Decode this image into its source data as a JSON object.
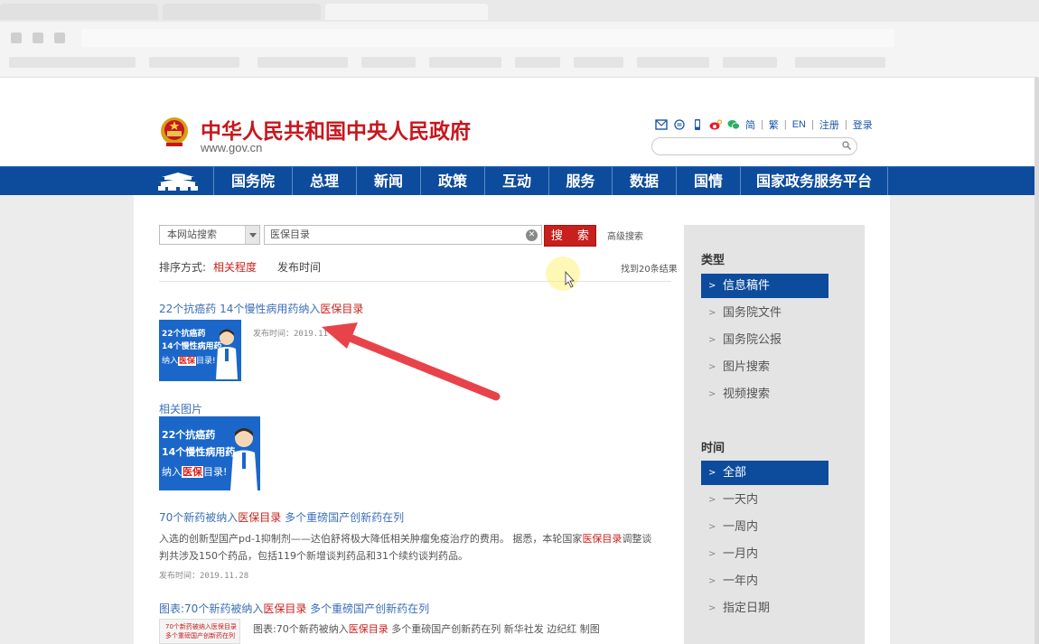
{
  "header": {
    "site_title": "中华人民共和国中央人民政府",
    "site_url": "www.gov.cn",
    "links": [
      "简",
      "繁",
      "EN",
      "注册",
      "登录"
    ],
    "icons": [
      "mail-icon",
      "rss-icon",
      "mobile-icon",
      "weibo-icon",
      "wechat-icon"
    ]
  },
  "nav": {
    "items": [
      "国务院",
      "总理",
      "新闻",
      "政策",
      "互动",
      "服务",
      "数据",
      "国情",
      "国家政务服务平台"
    ]
  },
  "search": {
    "scope": "本网站搜索",
    "query": "医保目录",
    "button": "搜 索",
    "advanced": "高级搜索"
  },
  "sort": {
    "label": "排序方式:",
    "relevance": "相关程度",
    "time": "发布时间",
    "found": "找到20条结果"
  },
  "results": [
    {
      "title_pre": "22个抗癌药 14个慢性病用药纳入",
      "title_hl": "医保目录",
      "meta": "发布时间：2019.11",
      "thumb_lines": [
        "22个抗癌药",
        "14个慢性病用药",
        "纳入",
        "医保",
        "目录!"
      ]
    },
    {
      "title": "相关图片",
      "thumb_lines": [
        "22个抗癌药",
        "14个慢性病用药",
        "纳入",
        "医保",
        "目录!"
      ]
    },
    {
      "title_pre": "70个新药被纳入",
      "title_hl": "医保目录",
      "title_post": "  多个重磅国产创新药在列",
      "line1_pre": "入选的创新型国产pd-1抑制剂——达伯舒将极大降低相关肿瘤免疫治疗的费用。 据悉，本轮国家",
      "line1_hl": "医保目录",
      "line1_post": "调整谈",
      "line2": "判共涉及150个药品，包括119个新增谈判药品和31个续约谈判药品。",
      "meta": "发布时间：2019.11.28"
    },
    {
      "title_pre": "图表:70个新药被纳入",
      "title_hl": "医保目录",
      "title_post": "  多个重磅国产创新药在列",
      "text_pre": "图表:70个新药被纳入",
      "text_hl": "医保目录",
      "text_post": "  多个重磅国产创新药在列  新华社发  边纪红  制图",
      "thumb_lines": [
        "70个新药被纳入医保目录",
        "多个重磅国产创新药在列"
      ]
    }
  ],
  "sidebar": {
    "type_heading": "类型",
    "type_items": [
      "信息稿件",
      "国务院文件",
      "国务院公报",
      "图片搜索",
      "视频搜索"
    ],
    "time_heading": "时间",
    "time_items": [
      "全部",
      "一天内",
      "一周内",
      "一月内",
      "一年内",
      "指定日期"
    ]
  },
  "colors": {
    "brand_red": "#c8161d",
    "nav_blue": "#0d4b9c",
    "link_blue": "#3b6fb8",
    "arrow": "#e8434a"
  }
}
